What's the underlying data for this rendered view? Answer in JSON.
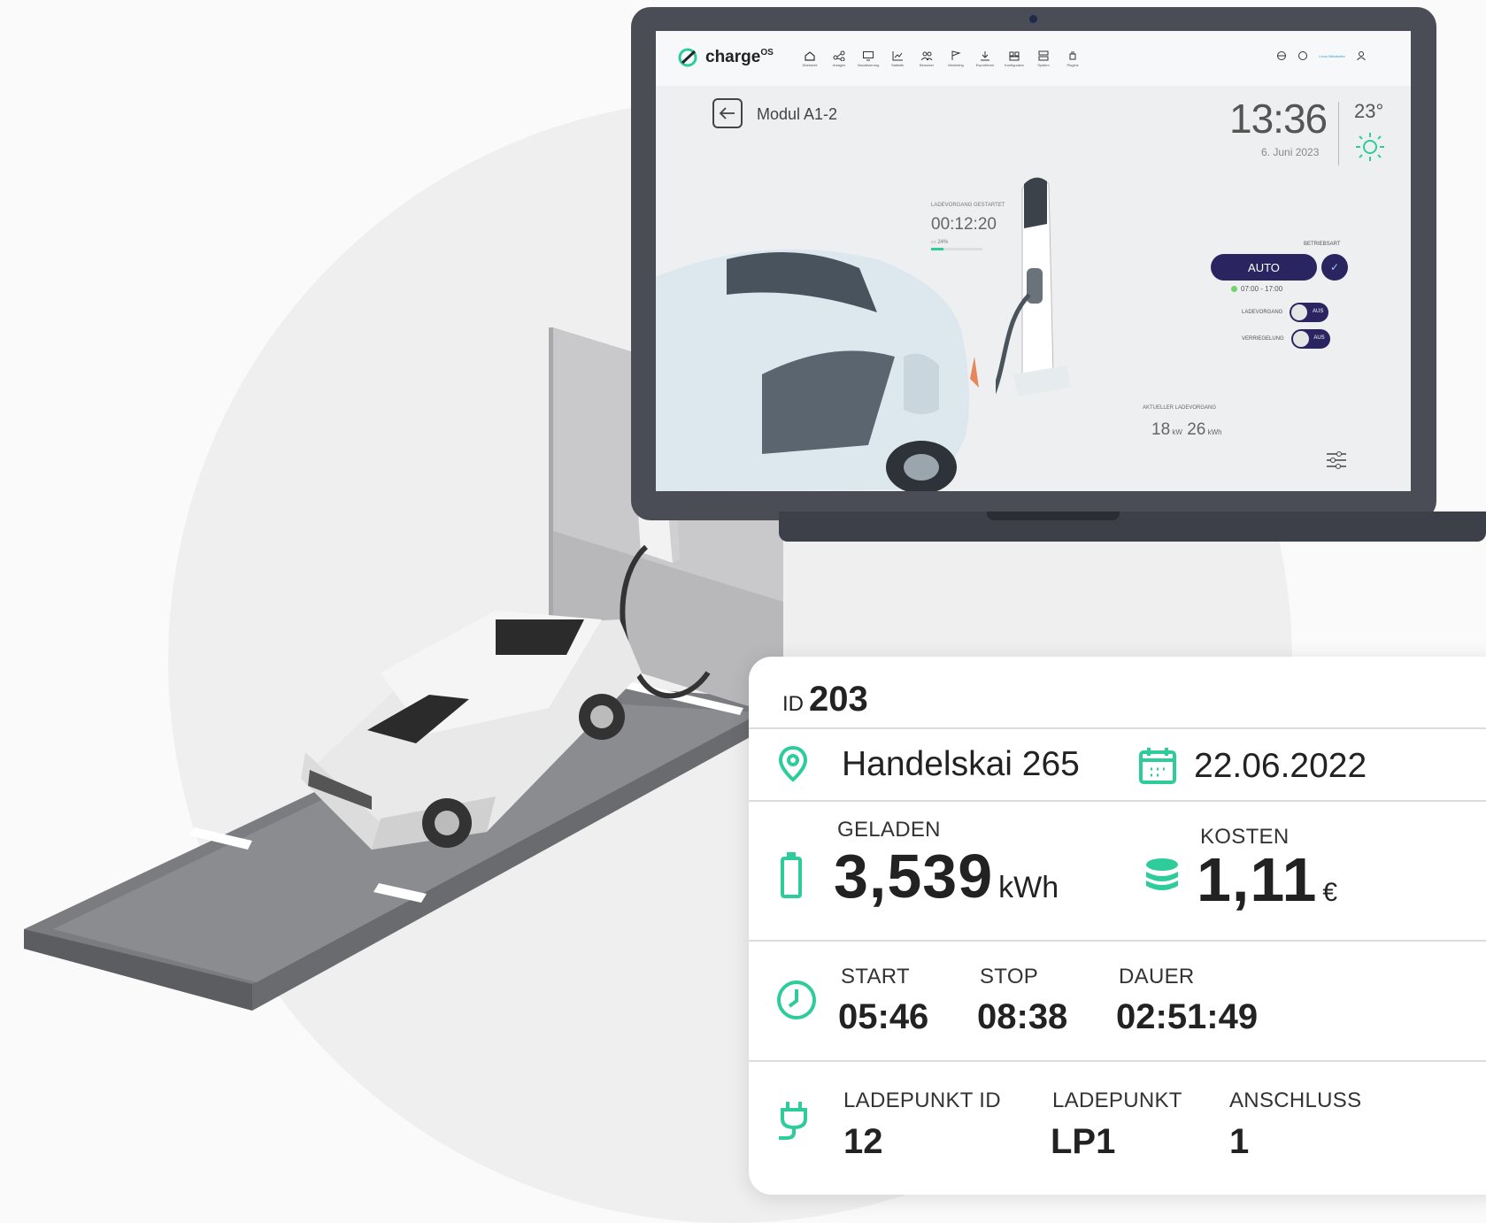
{
  "colors": {
    "accent_teal": "#2ecc9a",
    "nav_dark": "#2a2560",
    "background_circle": "#efefef"
  },
  "laptop": {
    "logo_text": "charge",
    "logo_sup": "OS",
    "nav": [
      {
        "icon": "home-icon",
        "label": "Übersicht"
      },
      {
        "icon": "network-icon",
        "label": "Anlagen"
      },
      {
        "icon": "monitor-icon",
        "label": "Visualisierung"
      },
      {
        "icon": "chart-icon",
        "label": "Statistik"
      },
      {
        "icon": "users-icon",
        "label": "Benutzer"
      },
      {
        "icon": "flag-icon",
        "label": "Marketing"
      },
      {
        "icon": "download-icon",
        "label": "Exportieren"
      },
      {
        "icon": "config-icon",
        "label": "Konfigurator"
      },
      {
        "icon": "server-icon",
        "label": "System"
      },
      {
        "icon": "plugin-icon",
        "label": "Plugins"
      }
    ],
    "user_label": "Linus Mitarbeiter",
    "module_title": "Modul A1-2",
    "time": "13:36",
    "date": "6. Juni 2023",
    "temperature": "23°",
    "session_label": "LADEVORGANG GESTARTET",
    "session_time": "00:12:20",
    "battery_label": "24%",
    "battery_fraction": 0.24,
    "mode_label": "BETRIEBSART",
    "mode_button": "AUTO",
    "schedule": "07:00 - 17:00",
    "toggle_charging_label": "LADEVORGANG",
    "toggle_charging_state": "AUS",
    "toggle_lock_label": "VERRIEGELUNG",
    "toggle_lock_state": "AUS",
    "current_label": "AKTUELLER LADEVORGANG",
    "power_value": "18",
    "power_unit": "kW",
    "energy_value": "26",
    "energy_unit": "kWh"
  },
  "card": {
    "id_label": "ID",
    "id_value": "203",
    "address": "Handelskai 265",
    "date": "22.06.2022",
    "charged_label": "GELADEN",
    "charged_value": "3,539",
    "charged_unit": "kWh",
    "cost_label": "KOSTEN",
    "cost_value": "1,11",
    "cost_unit": "€",
    "start_label": "START",
    "start_value": "05:46",
    "stop_label": "STOP",
    "stop_value": "08:38",
    "duration_label": "DAUER",
    "duration_value": "02:51:49",
    "chargepoint_id_label": "LADEPUNKT ID",
    "chargepoint_id_value": "12",
    "chargepoint_label": "LADEPUNKT",
    "chargepoint_value": "LP1",
    "connector_label": "ANSCHLUSS",
    "connector_value": "1"
  }
}
